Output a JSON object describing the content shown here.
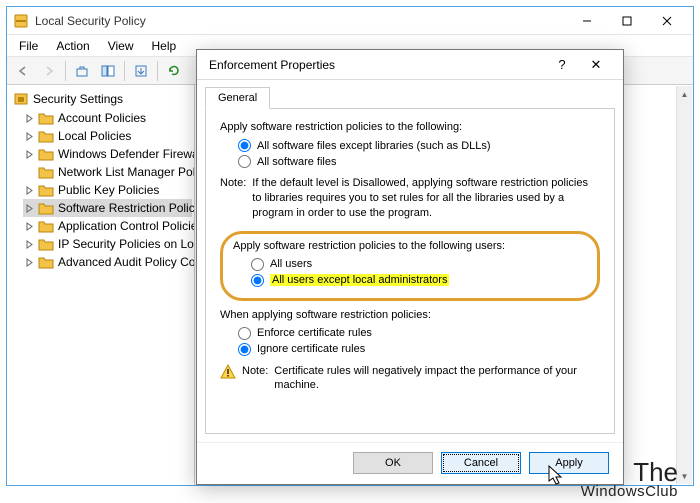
{
  "main_window": {
    "title": "Local Security Policy",
    "menu": [
      "File",
      "Action",
      "View",
      "Help"
    ],
    "tree_root": "Security Settings",
    "tree_items": [
      "Account Policies",
      "Local Policies",
      "Windows Defender Firewall",
      "Network List Manager Policies",
      "Public Key Policies",
      "Software Restriction Policies",
      "Application Control Policies",
      "IP Security Policies on Local",
      "Advanced Audit Policy Configuration"
    ],
    "selected_index": 5
  },
  "dialog": {
    "title": "Enforcement Properties",
    "help_symbol": "?",
    "close_symbol": "✕",
    "tab_label": "General",
    "section1": {
      "label": "Apply software restriction policies to the following:",
      "opt1": "All software files except libraries (such as DLLs)",
      "opt2": "All software files",
      "selected": 0,
      "note_label": "Note:",
      "note_text": "If the default level is Disallowed, applying software restriction policies to libraries requires you to set rules for all the libraries used by a program in order to use the program."
    },
    "section2": {
      "label": "Apply software restriction policies to the following users:",
      "opt1": "All users",
      "opt2": "All users except local administrators",
      "selected": 1
    },
    "section3": {
      "label": "When applying software restriction policies:",
      "opt1": "Enforce certificate rules",
      "opt2": "Ignore certificate rules",
      "selected": 1,
      "note_label": "Note:",
      "note_text": "Certificate rules will negatively impact the performance of your machine."
    },
    "buttons": {
      "ok": "OK",
      "cancel": "Cancel",
      "apply": "Apply"
    }
  },
  "watermark": {
    "line1": "The",
    "line2": "WindowsClub"
  }
}
